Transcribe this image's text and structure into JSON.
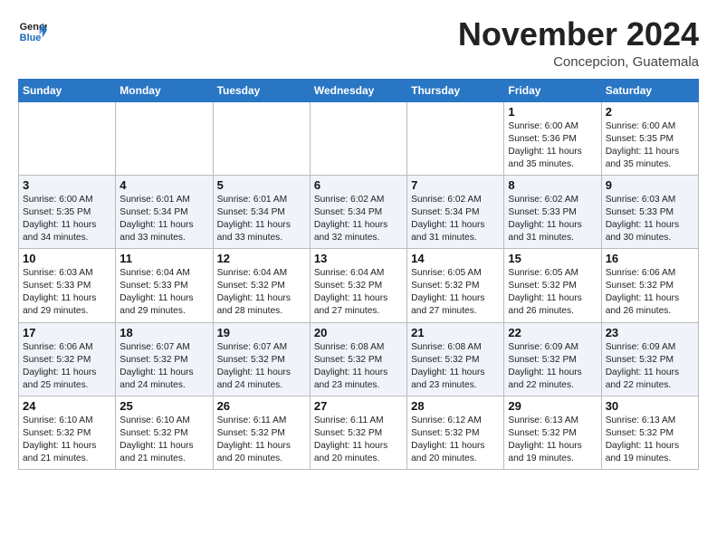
{
  "header": {
    "logo_line1": "General",
    "logo_line2": "Blue",
    "month": "November 2024",
    "location": "Concepcion, Guatemala"
  },
  "days_of_week": [
    "Sunday",
    "Monday",
    "Tuesday",
    "Wednesday",
    "Thursday",
    "Friday",
    "Saturday"
  ],
  "weeks": [
    [
      {
        "day": "",
        "info": ""
      },
      {
        "day": "",
        "info": ""
      },
      {
        "day": "",
        "info": ""
      },
      {
        "day": "",
        "info": ""
      },
      {
        "day": "",
        "info": ""
      },
      {
        "day": "1",
        "info": "Sunrise: 6:00 AM\nSunset: 5:36 PM\nDaylight: 11 hours\nand 35 minutes."
      },
      {
        "day": "2",
        "info": "Sunrise: 6:00 AM\nSunset: 5:35 PM\nDaylight: 11 hours\nand 35 minutes."
      }
    ],
    [
      {
        "day": "3",
        "info": "Sunrise: 6:00 AM\nSunset: 5:35 PM\nDaylight: 11 hours\nand 34 minutes."
      },
      {
        "day": "4",
        "info": "Sunrise: 6:01 AM\nSunset: 5:34 PM\nDaylight: 11 hours\nand 33 minutes."
      },
      {
        "day": "5",
        "info": "Sunrise: 6:01 AM\nSunset: 5:34 PM\nDaylight: 11 hours\nand 33 minutes."
      },
      {
        "day": "6",
        "info": "Sunrise: 6:02 AM\nSunset: 5:34 PM\nDaylight: 11 hours\nand 32 minutes."
      },
      {
        "day": "7",
        "info": "Sunrise: 6:02 AM\nSunset: 5:34 PM\nDaylight: 11 hours\nand 31 minutes."
      },
      {
        "day": "8",
        "info": "Sunrise: 6:02 AM\nSunset: 5:33 PM\nDaylight: 11 hours\nand 31 minutes."
      },
      {
        "day": "9",
        "info": "Sunrise: 6:03 AM\nSunset: 5:33 PM\nDaylight: 11 hours\nand 30 minutes."
      }
    ],
    [
      {
        "day": "10",
        "info": "Sunrise: 6:03 AM\nSunset: 5:33 PM\nDaylight: 11 hours\nand 29 minutes."
      },
      {
        "day": "11",
        "info": "Sunrise: 6:04 AM\nSunset: 5:33 PM\nDaylight: 11 hours\nand 29 minutes."
      },
      {
        "day": "12",
        "info": "Sunrise: 6:04 AM\nSunset: 5:32 PM\nDaylight: 11 hours\nand 28 minutes."
      },
      {
        "day": "13",
        "info": "Sunrise: 6:04 AM\nSunset: 5:32 PM\nDaylight: 11 hours\nand 27 minutes."
      },
      {
        "day": "14",
        "info": "Sunrise: 6:05 AM\nSunset: 5:32 PM\nDaylight: 11 hours\nand 27 minutes."
      },
      {
        "day": "15",
        "info": "Sunrise: 6:05 AM\nSunset: 5:32 PM\nDaylight: 11 hours\nand 26 minutes."
      },
      {
        "day": "16",
        "info": "Sunrise: 6:06 AM\nSunset: 5:32 PM\nDaylight: 11 hours\nand 26 minutes."
      }
    ],
    [
      {
        "day": "17",
        "info": "Sunrise: 6:06 AM\nSunset: 5:32 PM\nDaylight: 11 hours\nand 25 minutes."
      },
      {
        "day": "18",
        "info": "Sunrise: 6:07 AM\nSunset: 5:32 PM\nDaylight: 11 hours\nand 24 minutes."
      },
      {
        "day": "19",
        "info": "Sunrise: 6:07 AM\nSunset: 5:32 PM\nDaylight: 11 hours\nand 24 minutes."
      },
      {
        "day": "20",
        "info": "Sunrise: 6:08 AM\nSunset: 5:32 PM\nDaylight: 11 hours\nand 23 minutes."
      },
      {
        "day": "21",
        "info": "Sunrise: 6:08 AM\nSunset: 5:32 PM\nDaylight: 11 hours\nand 23 minutes."
      },
      {
        "day": "22",
        "info": "Sunrise: 6:09 AM\nSunset: 5:32 PM\nDaylight: 11 hours\nand 22 minutes."
      },
      {
        "day": "23",
        "info": "Sunrise: 6:09 AM\nSunset: 5:32 PM\nDaylight: 11 hours\nand 22 minutes."
      }
    ],
    [
      {
        "day": "24",
        "info": "Sunrise: 6:10 AM\nSunset: 5:32 PM\nDaylight: 11 hours\nand 21 minutes."
      },
      {
        "day": "25",
        "info": "Sunrise: 6:10 AM\nSunset: 5:32 PM\nDaylight: 11 hours\nand 21 minutes."
      },
      {
        "day": "26",
        "info": "Sunrise: 6:11 AM\nSunset: 5:32 PM\nDaylight: 11 hours\nand 20 minutes."
      },
      {
        "day": "27",
        "info": "Sunrise: 6:11 AM\nSunset: 5:32 PM\nDaylight: 11 hours\nand 20 minutes."
      },
      {
        "day": "28",
        "info": "Sunrise: 6:12 AM\nSunset: 5:32 PM\nDaylight: 11 hours\nand 20 minutes."
      },
      {
        "day": "29",
        "info": "Sunrise: 6:13 AM\nSunset: 5:32 PM\nDaylight: 11 hours\nand 19 minutes."
      },
      {
        "day": "30",
        "info": "Sunrise: 6:13 AM\nSunset: 5:32 PM\nDaylight: 11 hours\nand 19 minutes."
      }
    ]
  ]
}
